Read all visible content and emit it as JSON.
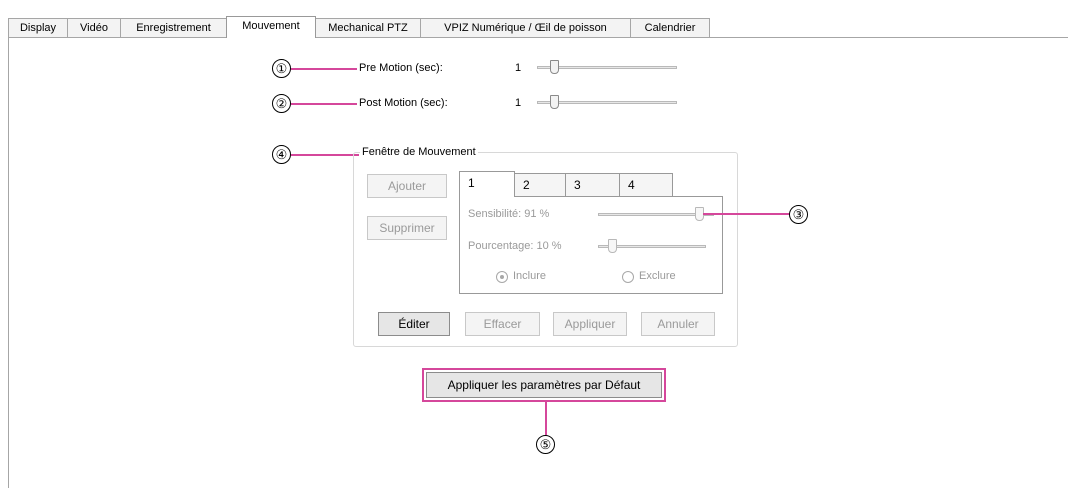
{
  "tabs": [
    {
      "label": "Display",
      "active": false
    },
    {
      "label": "Vidéo",
      "active": false
    },
    {
      "label": "Enregistrement",
      "active": false
    },
    {
      "label": "Mouvement",
      "active": true
    },
    {
      "label": "Mechanical PTZ",
      "active": false
    },
    {
      "label": "VPIZ Numérique / Œil de poisson",
      "active": false
    },
    {
      "label": "Calendrier",
      "active": false
    }
  ],
  "callouts": {
    "c1": "①",
    "c2": "②",
    "c3": "③",
    "c4": "④",
    "c5": "⑤"
  },
  "accent_color": "#d5479b",
  "pre_motion": {
    "label": "Pre Motion (sec):",
    "value": "1"
  },
  "post_motion": {
    "label": "Post Motion (sec):",
    "value": "1"
  },
  "motion_window": {
    "title": "Fenêtre de Mouvement",
    "add_button": "Ajouter",
    "delete_button": "Supprimer",
    "zone_tabs": [
      "1",
      "2",
      "3",
      "4"
    ],
    "sensitivity": {
      "label": "Sensibilité: 91 %",
      "value_percent": 91
    },
    "percentage": {
      "label": "Pourcentage: 10 %",
      "value_percent": 10
    },
    "include_label": "Inclure",
    "exclude_label": "Exclure",
    "include_checked": true,
    "edit_button": "Éditer",
    "clear_button": "Effacer",
    "apply_button": "Appliquer",
    "cancel_button": "Annuler"
  },
  "default_button": "Appliquer les paramètres par Défaut"
}
